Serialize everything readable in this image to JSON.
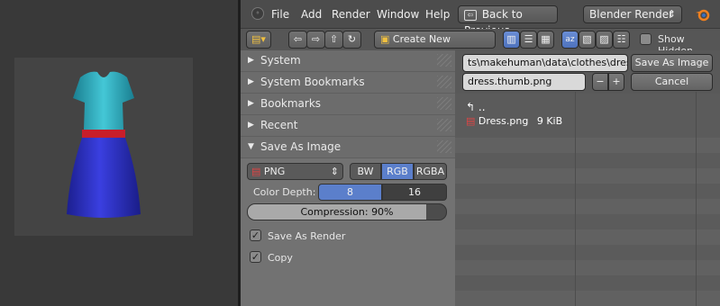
{
  "header": {
    "menu": [
      "File",
      "Add",
      "Render",
      "Window",
      "Help"
    ],
    "back_button": "Back to Previous",
    "engine_select": "Blender Render",
    "engine_arrow": "⇕"
  },
  "toolbar": {
    "create_dir": "Create New Directory",
    "show_hidden": "Show Hidden"
  },
  "panel": {
    "sections": {
      "system": "System",
      "system_bookmarks": "System Bookmarks",
      "bookmarks": "Bookmarks",
      "recent": "Recent",
      "save_as_image": "Save As Image"
    },
    "format": "PNG",
    "color_modes": [
      "BW",
      "RGB",
      "RGBA"
    ],
    "color_mode_selected": "RGB",
    "color_depth_label": "Color Depth:",
    "color_depths": [
      "8",
      "16"
    ],
    "compression": "Compression: 90%",
    "compression_value": 90,
    "save_as_render": "Save As Render",
    "copy": "Copy"
  },
  "files": {
    "path": "ts\\makehuman\\data\\clothes\\dress\\",
    "filename": "dress.thumb.png",
    "save_button": "Save As Image",
    "cancel_button": "Cancel",
    "parent_label": "..",
    "items": [
      {
        "name": "Dress.png",
        "size": "9 KiB"
      }
    ]
  },
  "colors": {
    "accent_blue": "#5b7fcb",
    "panel_gray": "#727272",
    "dress_teal": "#2aa6b8",
    "dress_blue": "#2c31c8",
    "belt_red": "#c81e2a"
  }
}
